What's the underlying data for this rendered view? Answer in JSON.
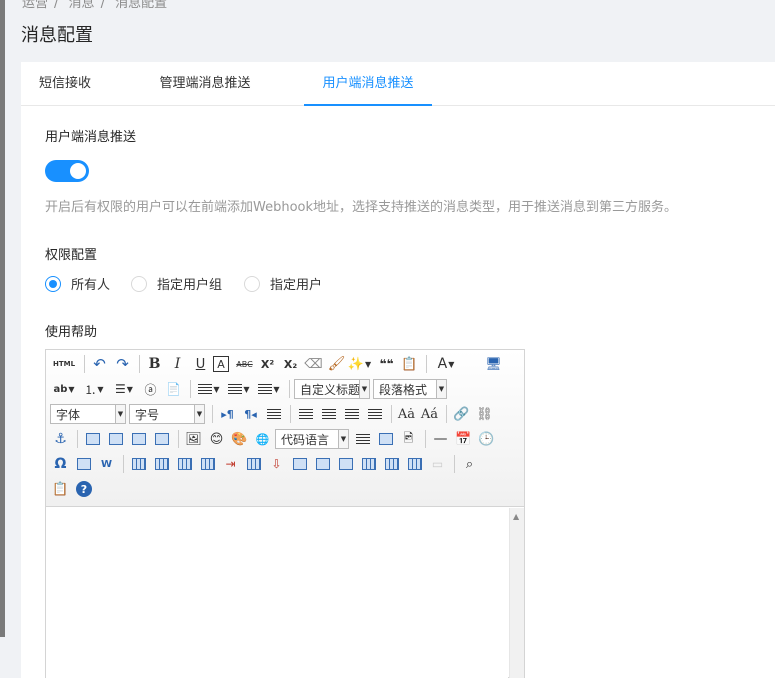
{
  "breadcrumb": [
    "运营",
    "消息",
    "消息配置"
  ],
  "page_title": "消息配置",
  "tabs": [
    {
      "label": "短信接收",
      "active": false
    },
    {
      "label": "管理端消息推送",
      "active": false
    },
    {
      "label": "用户端消息推送",
      "active": true
    }
  ],
  "push_section": {
    "title": "用户端消息推送",
    "enabled": true,
    "description": "开启后有权限的用户可以在前端添加Webhook地址，选择支持推送的消息类型，用于推送消息到第三方服务。"
  },
  "permission": {
    "title": "权限配置",
    "options": [
      "所有人",
      "指定用户组",
      "指定用户"
    ],
    "selected": "所有人"
  },
  "help": {
    "title": "使用帮助"
  },
  "editor": {
    "source_label": "HTML",
    "custom_title_combo": "自定义标题",
    "paragraph_combo": "段落格式",
    "font_combo": "字体",
    "size_combo": "字号",
    "code_lang_combo": "代码语言",
    "bold": "B",
    "italic": "I",
    "underline": "U",
    "strike": "ABC",
    "sup": "X²",
    "sub": "X₂",
    "blockquote": "❝❝",
    "font_color": "A"
  },
  "colors": {
    "accent": "#1890ff",
    "page_bg": "#f0f2f5",
    "muted_text": "#999999"
  }
}
